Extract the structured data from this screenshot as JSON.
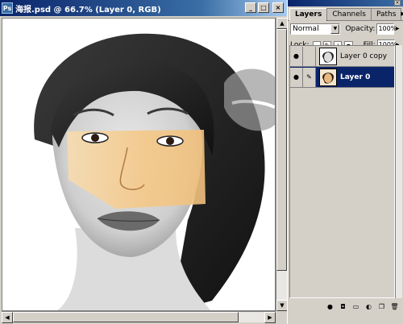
{
  "document": {
    "icon_glyph": "Ps",
    "title": "海报.psd @ 66.7% (Layer 0, RGB)",
    "minimize_glyph": "_",
    "maximize_glyph": "□",
    "close_glyph": "×"
  },
  "palette": {
    "close_glyph": "×",
    "tabs": [
      {
        "label": "Layers",
        "active": true
      },
      {
        "label": "Channels",
        "active": false
      },
      {
        "label": "Paths",
        "active": false
      }
    ],
    "menu_arrow": "▶",
    "blend_mode": "Normal",
    "opacity_label": "Opacity:",
    "opacity_value": "100%",
    "lock_label": "Lock:",
    "fill_label": "Fill:",
    "fill_value": "100%",
    "layers": [
      {
        "name": "Layer 0 copy",
        "selected": false,
        "visible": true
      },
      {
        "name": "Layer 0",
        "selected": true,
        "visible": true
      }
    ],
    "bottom_icons": [
      "fx-icon",
      "mask-icon",
      "folder-icon",
      "adjustment-icon",
      "new-layer-icon",
      "trash-icon"
    ]
  },
  "icons": {
    "eye": "●",
    "brush": "✎",
    "link": "⛓",
    "dropdown": "▼",
    "scroll_up": "▲",
    "scroll_down": "▼",
    "scroll_left": "◀",
    "scroll_right": "▶"
  },
  "colors": {
    "title_bar": "#0a246a",
    "selection": "#0a246a",
    "panel_bg": "#d4d0c8",
    "skin_highlight": "#f4c98a"
  }
}
